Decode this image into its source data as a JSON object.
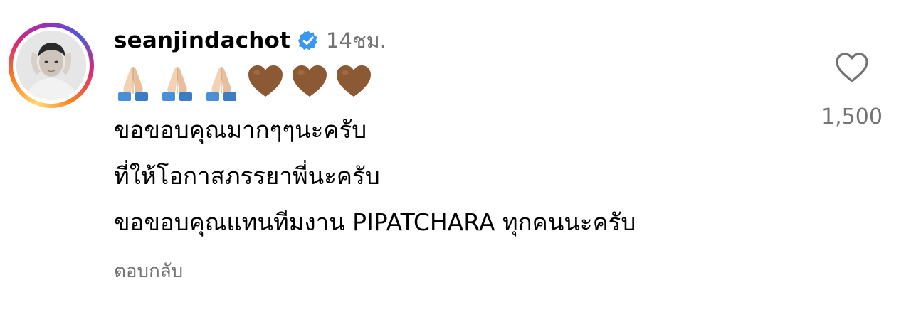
{
  "comment": {
    "username": "seanjindachot",
    "verified": true,
    "timestamp": "14ชม.",
    "emojis": [
      {
        "icon": "folded-hands-icon"
      },
      {
        "icon": "folded-hands-icon"
      },
      {
        "icon": "folded-hands-icon"
      },
      {
        "icon": "brown-heart-icon"
      },
      {
        "icon": "brown-heart-icon"
      },
      {
        "icon": "brown-heart-icon"
      }
    ],
    "lines": [
      "ขอขอบคุณมากๆๆนะครับ",
      "ที่ให้โอกาสภรรยาพี่นะครับ",
      "ขอขอบคุณแทนทีมงาน PIPATCHARA ทุกคนนะครับ"
    ],
    "reply_label": "ตอบกลับ",
    "like_count": "1,500"
  },
  "colors": {
    "text": "#000000",
    "secondary": "#737373",
    "verified_blue": "#3897f0",
    "brown_heart": "#8b5a34",
    "skin_tone": "#f3d1b3",
    "sleeve_blue": "#4a90d9"
  }
}
